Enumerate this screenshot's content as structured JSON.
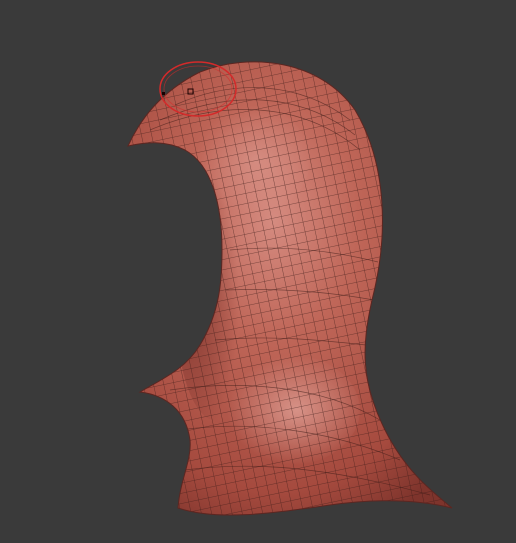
{
  "viewport": {
    "background": "#3a3a3a"
  },
  "mesh": {
    "name": "hood-mesh",
    "base_color": "#b75a4c",
    "highlight_color": "#d78f84",
    "shadow_color": "#8a3a32",
    "wire_color": "#3a1a16"
  },
  "brush_cursor": {
    "icon": "brush-circle-icon",
    "ring_color": "#d42a2a"
  }
}
